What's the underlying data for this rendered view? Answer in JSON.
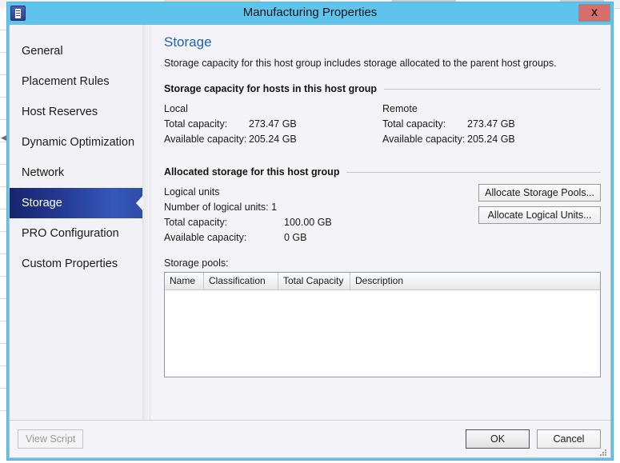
{
  "window": {
    "title": "Manufacturing Properties",
    "icon": "properties-document-icon",
    "close_label": "X",
    "titlebar_color": "#5fc3ec",
    "close_button_color": "#d66f6a"
  },
  "sidebar": {
    "items": [
      {
        "label": "General",
        "selected": false
      },
      {
        "label": "Placement Rules",
        "selected": false
      },
      {
        "label": "Host Reserves",
        "selected": false
      },
      {
        "label": "Dynamic Optimization",
        "selected": false
      },
      {
        "label": "Network",
        "selected": false
      },
      {
        "label": "Storage",
        "selected": true
      },
      {
        "label": "PRO Configuration",
        "selected": false
      },
      {
        "label": "Custom Properties",
        "selected": false
      }
    ],
    "selected_color": "#23378f"
  },
  "content": {
    "title": "Storage",
    "title_color": "#2062ae",
    "description": "Storage capacity for this host group includes storage allocated to the parent host groups.",
    "capacity_section": {
      "heading": "Storage capacity for hosts in this host group",
      "columns": [
        {
          "title": "Local",
          "total_label": "Total capacity:",
          "total_value": "273.47 GB",
          "available_label": "Available capacity:",
          "available_value": "205.24 GB"
        },
        {
          "title": "Remote",
          "total_label": "Total capacity:",
          "total_value": "273.47 GB",
          "available_label": "Available capacity:",
          "available_value": "205.24 GB"
        }
      ]
    },
    "allocated_section": {
      "heading": "Allocated storage for this host group",
      "logical_units_label": "Logical units",
      "number_label": "Number of logical units:",
      "number_value": "1",
      "total_label": "Total capacity:",
      "total_value": "100.00 GB",
      "available_label": "Available capacity:",
      "available_value": "0 GB",
      "allocate_storage_pools_button": "Allocate Storage Pools...",
      "allocate_logical_units_button": "Allocate Logical Units..."
    },
    "pools": {
      "label": "Storage pools:",
      "columns": [
        "Name",
        "Classification",
        "Total Capacity",
        "Description"
      ],
      "rows": []
    }
  },
  "footer": {
    "view_script_label": "View Script",
    "view_script_enabled": false,
    "ok_label": "OK",
    "cancel_label": "Cancel",
    "resize_grip": "resize-grip-icon"
  }
}
